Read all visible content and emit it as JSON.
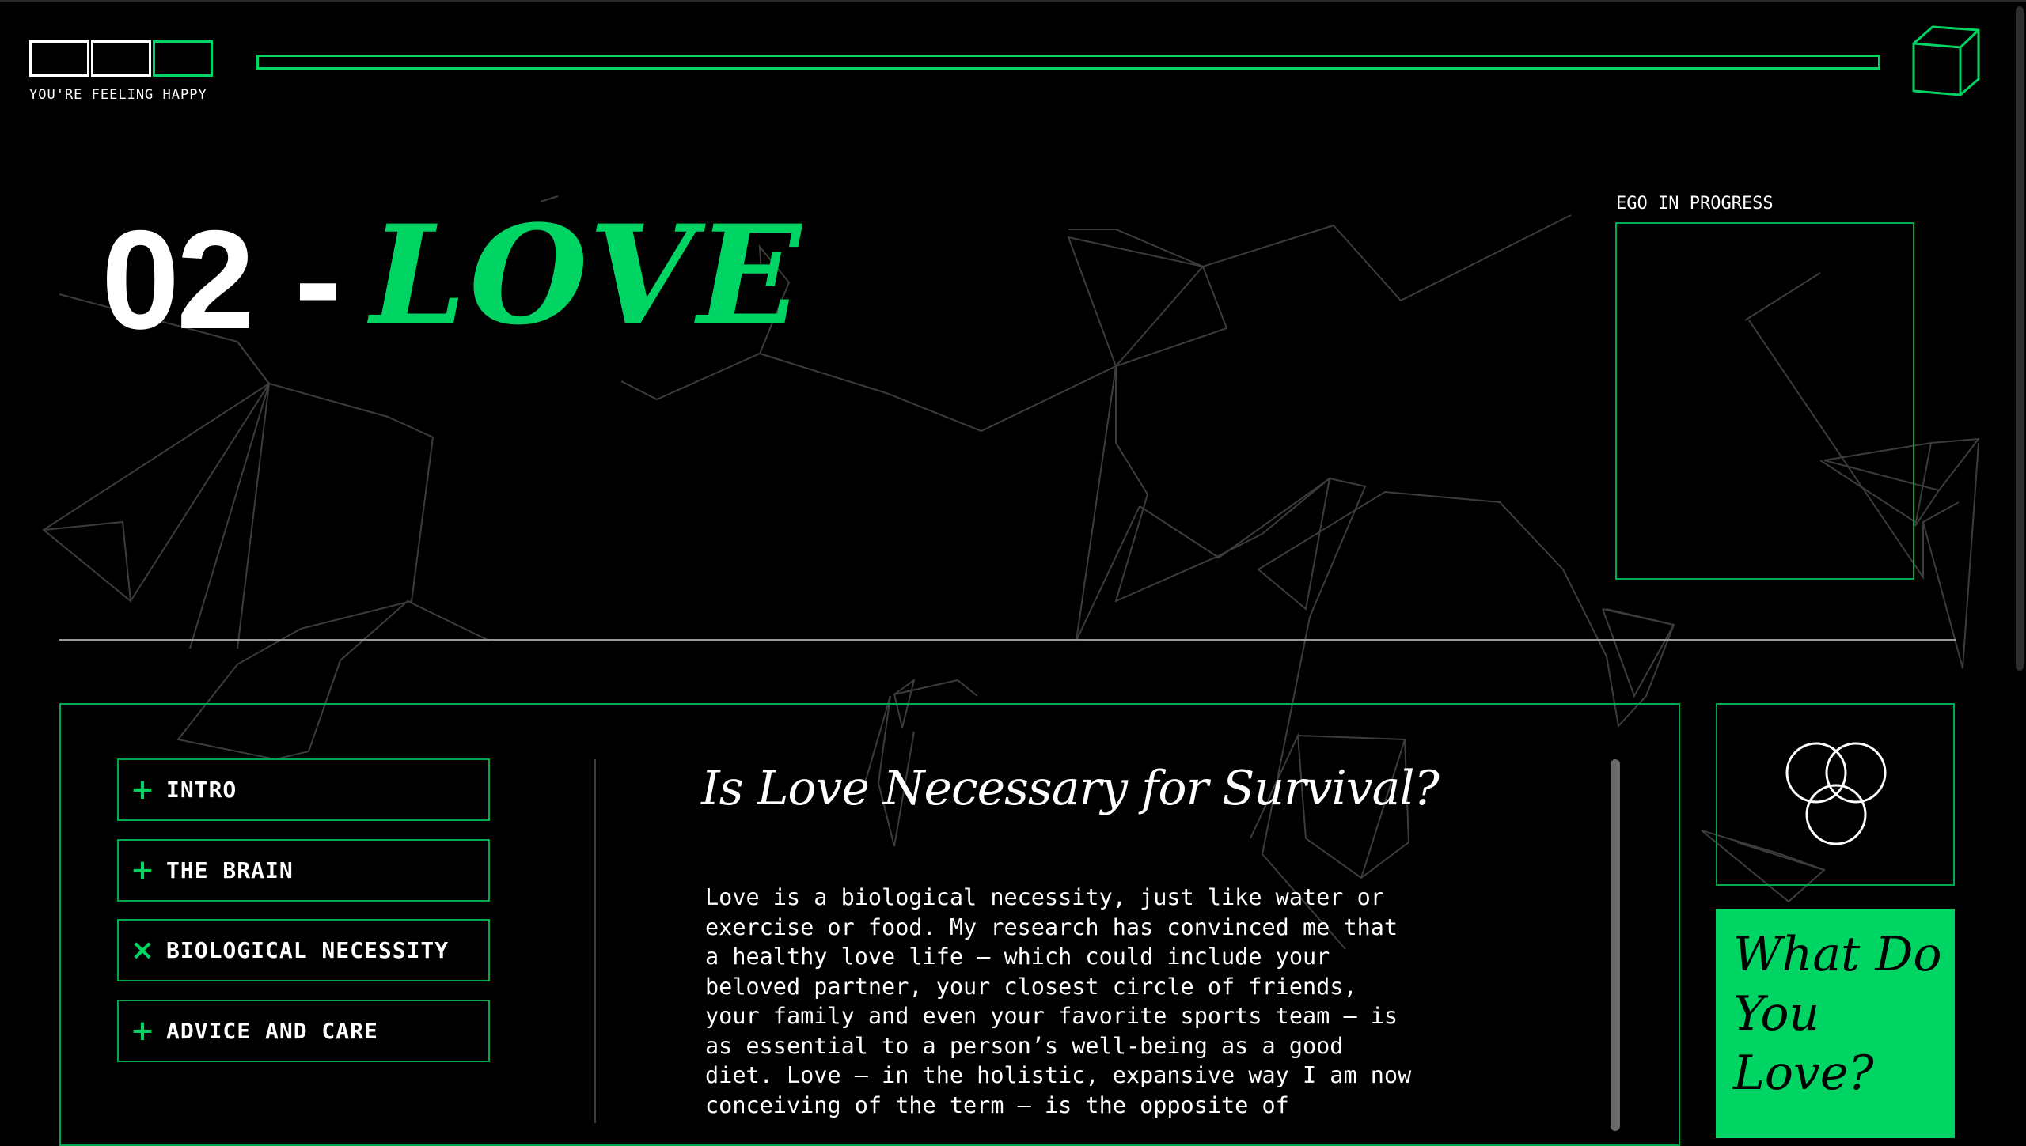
{
  "mood": {
    "label": "YOU'RE FEELING HAPPY",
    "segments": [
      "white",
      "white",
      "green"
    ]
  },
  "chapter": {
    "number": "02",
    "dash": "-",
    "word": "LOVE"
  },
  "ego": {
    "label": "EGO IN PROGRESS"
  },
  "toc": {
    "items": [
      {
        "icon": "+",
        "label": "INTRO"
      },
      {
        "icon": "+",
        "label": "THE BRAIN"
      },
      {
        "icon": "×",
        "label": "BIOLOGICAL NECESSITY"
      },
      {
        "icon": "+",
        "label": "ADVICE AND CARE"
      }
    ]
  },
  "article": {
    "title": "Is Love Necessary for Survival?",
    "lines": [
      "Love is a biological necessity, just like water or",
      "exercise or food. My research has convinced me that",
      "a healthy love life — which could include your",
      "beloved partner, your closest circle of friends,",
      "your family and even your favorite sports team — is",
      "as essential to a person’s well-being as a good",
      "diet. Love — in the holistic, expansive way I am now",
      "conceiving of the term — is the opposite of"
    ]
  },
  "cta": {
    "text": "What Do You Love?"
  },
  "colors": {
    "accent": "#00d563",
    "border": "#00a84e",
    "background": "#000000",
    "text": "#ffffff"
  },
  "icons": {
    "top_right": "cube-icon",
    "card": "venn-circles-icon"
  }
}
